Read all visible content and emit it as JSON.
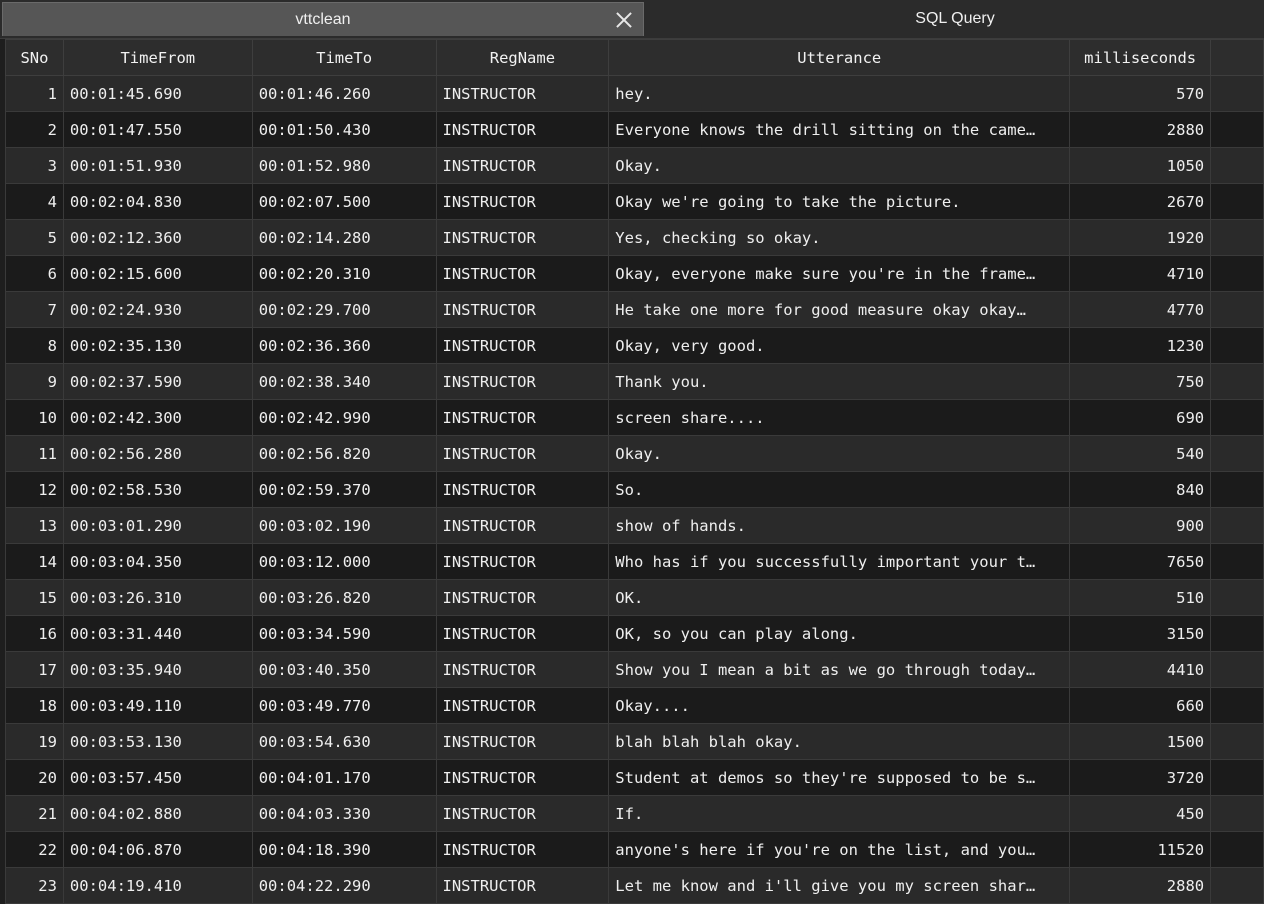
{
  "tabs": [
    {
      "label": "vttclean",
      "active": true,
      "closable": true
    },
    {
      "label": "SQL Query",
      "active": false,
      "closable": false
    }
  ],
  "table": {
    "columns": [
      "SNo",
      "TimeFrom",
      "TimeTo",
      "RegName",
      "Utterance",
      "milliseconds"
    ],
    "rows": [
      [
        "1",
        "00:01:45.690",
        "00:01:46.260",
        "INSTRUCTOR",
        "hey.",
        "570"
      ],
      [
        "2",
        "00:01:47.550",
        "00:01:50.430",
        "INSTRUCTOR",
        "Everyone knows the drill sitting on the came…",
        "2880"
      ],
      [
        "3",
        "00:01:51.930",
        "00:01:52.980",
        "INSTRUCTOR",
        "Okay.",
        "1050"
      ],
      [
        "4",
        "00:02:04.830",
        "00:02:07.500",
        "INSTRUCTOR",
        "Okay we're going to take the picture.",
        "2670"
      ],
      [
        "5",
        "00:02:12.360",
        "00:02:14.280",
        "INSTRUCTOR",
        "Yes, checking so okay.",
        "1920"
      ],
      [
        "6",
        "00:02:15.600",
        "00:02:20.310",
        "INSTRUCTOR",
        "Okay, everyone make sure you're in the frame…",
        "4710"
      ],
      [
        "7",
        "00:02:24.930",
        "00:02:29.700",
        "INSTRUCTOR",
        "He take one more for good measure okay okay…",
        "4770"
      ],
      [
        "8",
        "00:02:35.130",
        "00:02:36.360",
        "INSTRUCTOR",
        "Okay, very good.",
        "1230"
      ],
      [
        "9",
        "00:02:37.590",
        "00:02:38.340",
        "INSTRUCTOR",
        "Thank you.",
        "750"
      ],
      [
        "10",
        "00:02:42.300",
        "00:02:42.990",
        "INSTRUCTOR",
        "screen share....",
        "690"
      ],
      [
        "11",
        "00:02:56.280",
        "00:02:56.820",
        "INSTRUCTOR",
        "Okay.",
        "540"
      ],
      [
        "12",
        "00:02:58.530",
        "00:02:59.370",
        "INSTRUCTOR",
        "So.",
        "840"
      ],
      [
        "13",
        "00:03:01.290",
        "00:03:02.190",
        "INSTRUCTOR",
        "show of hands.",
        "900"
      ],
      [
        "14",
        "00:03:04.350",
        "00:03:12.000",
        "INSTRUCTOR",
        "Who has if you successfully important your t…",
        "7650"
      ],
      [
        "15",
        "00:03:26.310",
        "00:03:26.820",
        "INSTRUCTOR",
        "OK.",
        "510"
      ],
      [
        "16",
        "00:03:31.440",
        "00:03:34.590",
        "INSTRUCTOR",
        "OK, so you can play along.",
        "3150"
      ],
      [
        "17",
        "00:03:35.940",
        "00:03:40.350",
        "INSTRUCTOR",
        "Show you I mean a bit as we go through today…",
        "4410"
      ],
      [
        "18",
        "00:03:49.110",
        "00:03:49.770",
        "INSTRUCTOR",
        "Okay....",
        "660"
      ],
      [
        "19",
        "00:03:53.130",
        "00:03:54.630",
        "INSTRUCTOR",
        "blah blah blah okay.",
        "1500"
      ],
      [
        "20",
        "00:03:57.450",
        "00:04:01.170",
        "INSTRUCTOR",
        "Student at demos so they're supposed to be s…",
        "3720"
      ],
      [
        "21",
        "00:04:02.880",
        "00:04:03.330",
        "INSTRUCTOR",
        "If.",
        "450"
      ],
      [
        "22",
        "00:04:06.870",
        "00:04:18.390",
        "INSTRUCTOR",
        "anyone's here if you're on the list, and you…",
        "11520"
      ],
      [
        "23",
        "00:04:19.410",
        "00:04:22.290",
        "INSTRUCTOR",
        "Let me know and i'll give you my screen shar…",
        "2880"
      ]
    ]
  }
}
